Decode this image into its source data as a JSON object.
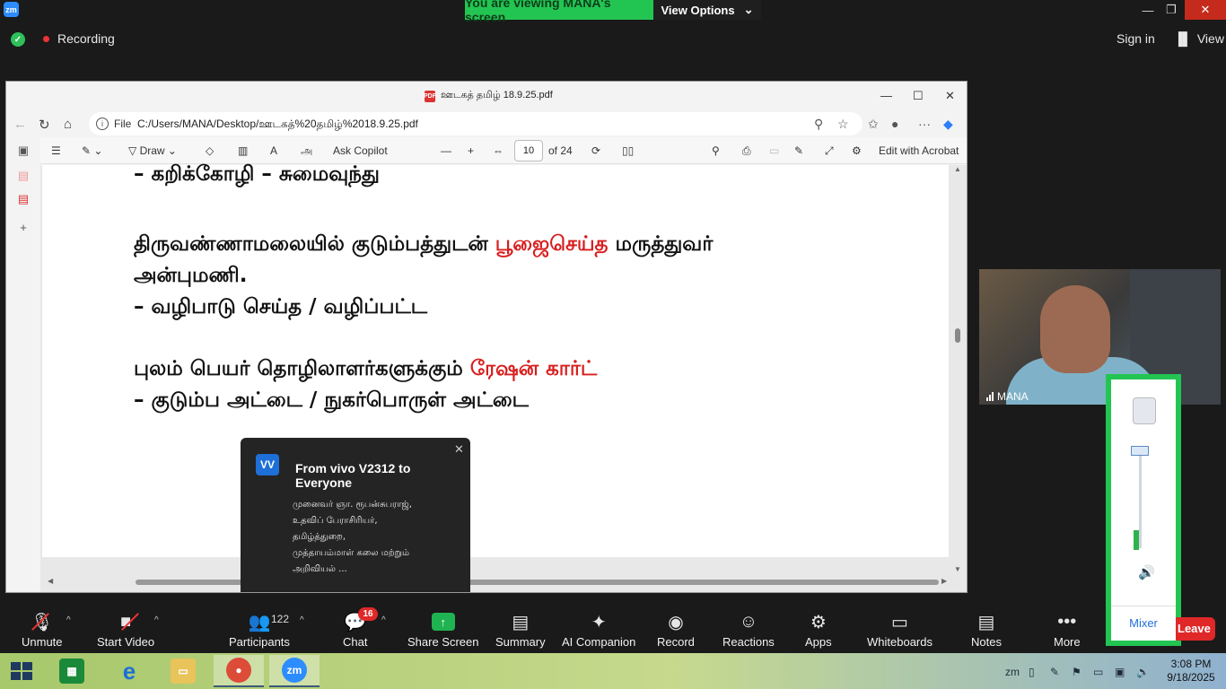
{
  "zoom": {
    "logo": "zm",
    "banner_text": "You are viewing MANA's screen",
    "view_options": "View Options",
    "recording": "Recording",
    "sign_in": "Sign in",
    "view": "View"
  },
  "browser": {
    "tab_title": "ஊடகத் தமிழ் 18.9.25.pdf",
    "file_label": "File",
    "url": "C:/Users/MANA/Desktop/ஊடகத்%20தமிழ்%2018.9.25.pdf"
  },
  "pdf_toolbar": {
    "draw": "Draw",
    "ask_copilot": "Ask Copilot",
    "page_current": "10",
    "page_total": "of 24",
    "edit_acrobat": "Edit with Acrobat"
  },
  "pdf_content": {
    "line1": "– கறிக்கோழி      – சுமைவுந்து",
    "line2_black_a": "திருவண்ணாமலையில் குடும்பத்துடன் ",
    "line2_red": "பூஜைசெய்த",
    "line2_black_b": " மருத்துவர்",
    "line3": "அன்புமணி.",
    "line4": "– வழிபாடு செய்த / வழிப்பட்ட",
    "line5_black": "புலம் பெயர் தொழிலாளர்களுக்கும் ",
    "line5_red": "ரேஷன் கார்ட்",
    "line6": "– குடும்ப    அட்டை / நுகர்பொருள் அட்டை"
  },
  "chat_popup": {
    "avatar": "VV",
    "from": "From vivo V2312 to Everyone",
    "message_lines": [
      "முனைவர் ஞா. ரூபன்சுபராஜ்,",
      " உதவிப் பேராசிரியர்,",
      "தமிழ்த்துறை,",
      "முத்தாயம்மாள் கலை மற்றும்",
      "அறிவியல் ..."
    ]
  },
  "video": {
    "name": "MANA"
  },
  "mixer": {
    "label": "Mixer",
    "level": 0.2
  },
  "leave": "Leave",
  "toolbar": {
    "unmute": "Unmute",
    "start_video": "Start Video",
    "participants": "Participants",
    "participants_count": "122",
    "chat": "Chat",
    "chat_badge": "16",
    "share_screen": "Share Screen",
    "summary": "Summary",
    "ai_companion": "AI Companion",
    "record": "Record",
    "reactions": "Reactions",
    "apps": "Apps",
    "whiteboards": "Whiteboards",
    "notes": "Notes",
    "more": "More"
  },
  "taskbar": {
    "time": "3:08 PM",
    "date": "9/18/2025"
  }
}
